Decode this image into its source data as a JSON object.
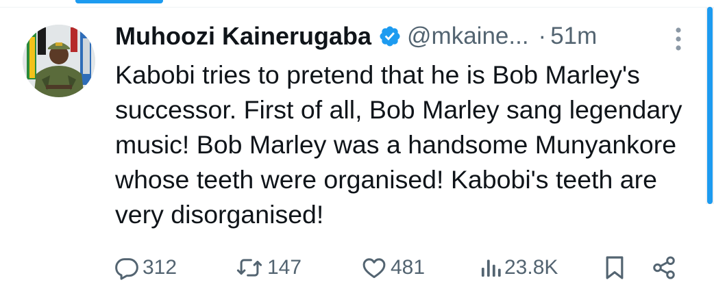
{
  "colors": {
    "accent": "#1d9bf0",
    "text": "#0f1419",
    "secondary": "#536471"
  },
  "tweet": {
    "author_name": "Muhoozi Kainerugaba",
    "verified_icon": "verified-badge-icon",
    "handle": "@mkaine...",
    "separator": "·",
    "time": "51m",
    "text": "Kabobi tries to pretend that he is Bob Marley's successor. First of all, Bob Marley sang legendary music! Bob Marley was a handsome Munyankore whose teeth were organised! Kabobi's teeth are very disorganised!"
  },
  "actions": {
    "reply": {
      "icon": "reply-icon",
      "count": "312"
    },
    "retweet": {
      "icon": "retweet-icon",
      "count": "147"
    },
    "like": {
      "icon": "heart-icon",
      "count": "481"
    },
    "views": {
      "icon": "views-icon",
      "count": "23.8K"
    },
    "bookmark": {
      "icon": "bookmark-icon"
    },
    "share": {
      "icon": "share-icon"
    }
  }
}
